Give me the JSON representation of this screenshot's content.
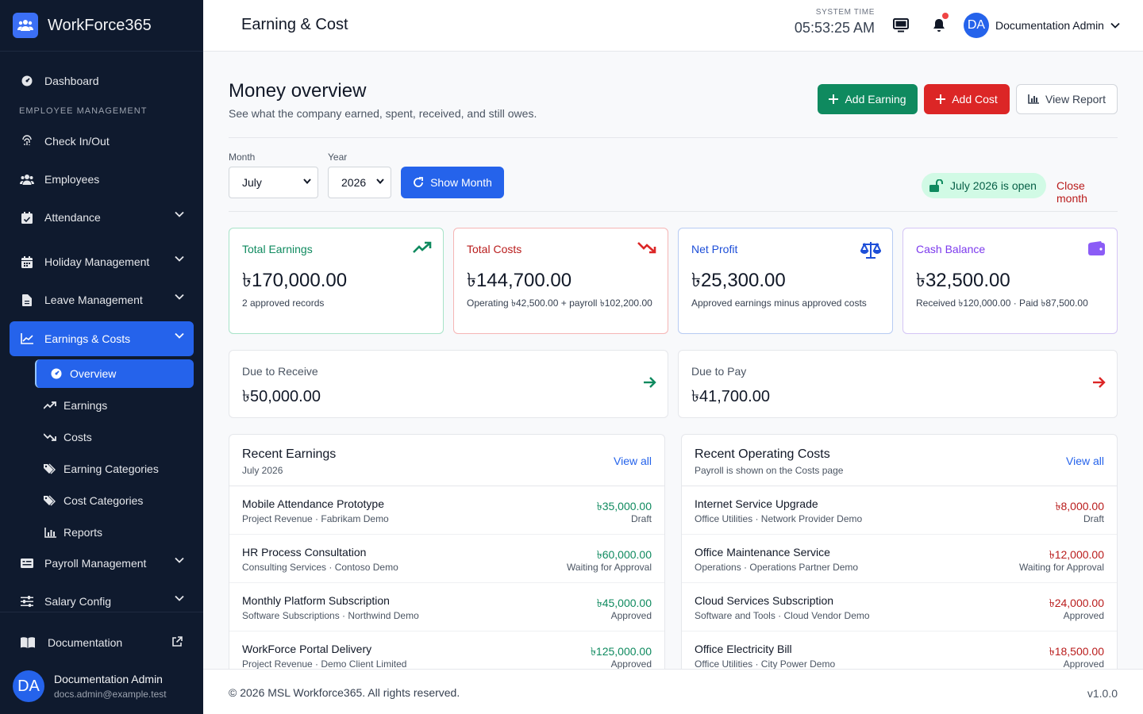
{
  "brand": {
    "name": "WorkForce365"
  },
  "colors": {
    "primary": "#2563eb",
    "success": "#0f8a5f",
    "danger": "#dc2626",
    "sidebar": "#0f1a2e",
    "purple": "#7c3aed"
  },
  "sidebar": {
    "dashboard": "Dashboard",
    "section": "EMPLOYEE MANAGEMENT",
    "items": [
      {
        "label": "Check In/Out",
        "icon": "fingerprint-icon"
      },
      {
        "label": "Employees",
        "icon": "users-icon"
      },
      {
        "label": "Attendance",
        "icon": "calendar-check-icon"
      },
      {
        "label": "Holiday Management",
        "icon": "calendar-icon"
      },
      {
        "label": "Leave Management",
        "icon": "file-icon"
      },
      {
        "label": "Earnings & Costs",
        "icon": "chart-line-icon"
      },
      {
        "label": "Payroll Management",
        "icon": "money-card-icon"
      },
      {
        "label": "Salary Config",
        "icon": "sliders-icon"
      }
    ],
    "subitems": [
      {
        "label": "Overview",
        "icon": "gauge-icon"
      },
      {
        "label": "Earnings",
        "icon": "trend-up-icon"
      },
      {
        "label": "Costs",
        "icon": "trend-down-icon"
      },
      {
        "label": "Earning Categories",
        "icon": "tags-icon"
      },
      {
        "label": "Cost Categories",
        "icon": "tags-icon"
      },
      {
        "label": "Reports",
        "icon": "bar-chart-icon"
      }
    ],
    "documentation": "Documentation",
    "user": {
      "initials": "DA",
      "name": "Documentation Admin",
      "email": "docs.admin@example.test"
    }
  },
  "header": {
    "title": "Earning & Cost",
    "clock_label": "SYSTEM TIME",
    "clock_time": "05:53:25 AM",
    "user_initials": "DA",
    "user_name": "Documentation Admin"
  },
  "page": {
    "title": "Money overview",
    "subtitle": "See what the company earned, spent, received, and still owes.",
    "add_earning": "Add Earning",
    "add_cost": "Add Cost",
    "view_report": "View Report"
  },
  "filters": {
    "month_label": "Month",
    "month_value": "July",
    "year_label": "Year",
    "year_value": "2026",
    "show_button": "Show Month",
    "status": "July 2026 is open",
    "close_link": "Close month"
  },
  "kpis": [
    {
      "label": "Total Earnings",
      "value": "৳170,000.00",
      "note": "2 approved records",
      "color": "#0f8a5f",
      "border": "#a7e3c8"
    },
    {
      "label": "Total Costs",
      "value": "৳144,700.00",
      "note": "Operating ৳42,500.00 + payroll ৳102,200.00",
      "color": "#b91c1c",
      "border": "#f5b5b5"
    },
    {
      "label": "Net Profit",
      "value": "৳25,300.00",
      "note": "Approved earnings minus approved costs",
      "color": "#1d4ed8",
      "border": "#b7cbf3"
    },
    {
      "label": "Cash Balance",
      "value": "৳32,500.00",
      "note": "Received ৳120,000.00 · Paid ৳87,500.00",
      "color": "#7c3aed",
      "border": "#d4c5f5"
    }
  ],
  "due": {
    "receive_label": "Due to Receive",
    "receive_value": "৳50,000.00",
    "pay_label": "Due to Pay",
    "pay_value": "৳41,700.00"
  },
  "recent_earnings": {
    "title": "Recent Earnings",
    "subtitle": "July 2026",
    "link": "View all",
    "rows": [
      {
        "name": "Mobile Attendance Prototype",
        "meta": "Project Revenue · Fabrikam Demo",
        "amount": "৳35,000.00",
        "status": "Draft"
      },
      {
        "name": "HR Process Consultation",
        "meta": "Consulting Services · Contoso Demo",
        "amount": "৳60,000.00",
        "status": "Waiting for Approval"
      },
      {
        "name": "Monthly Platform Subscription",
        "meta": "Software Subscriptions · Northwind Demo",
        "amount": "৳45,000.00",
        "status": "Approved"
      },
      {
        "name": "WorkForce Portal Delivery",
        "meta": "Project Revenue · Demo Client Limited",
        "amount": "৳125,000.00",
        "status": "Approved"
      }
    ]
  },
  "recent_costs": {
    "title": "Recent Operating Costs",
    "subtitle": "Payroll is shown on the Costs page",
    "link": "View all",
    "rows": [
      {
        "name": "Internet Service Upgrade",
        "meta": "Office Utilities · Network Provider Demo",
        "amount": "৳8,000.00",
        "status": "Draft"
      },
      {
        "name": "Office Maintenance Service",
        "meta": "Operations · Operations Partner Demo",
        "amount": "৳12,000.00",
        "status": "Waiting for Approval"
      },
      {
        "name": "Cloud Services Subscription",
        "meta": "Software and Tools · Cloud Vendor Demo",
        "amount": "৳24,000.00",
        "status": "Approved"
      },
      {
        "name": "Office Electricity Bill",
        "meta": "Office Utilities · City Power Demo",
        "amount": "৳18,500.00",
        "status": "Approved"
      }
    ]
  },
  "footer": {
    "copyright": "© 2026 MSL Workforce365. All rights reserved.",
    "version": "v1.0.0"
  }
}
